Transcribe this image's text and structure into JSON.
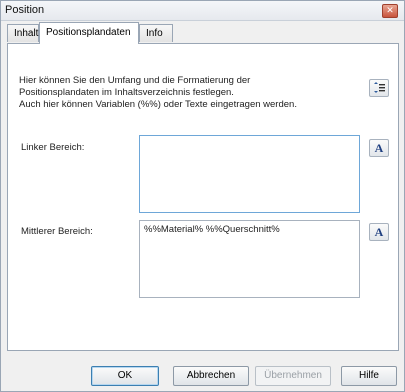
{
  "window": {
    "title": "Position",
    "close_glyph": "✕"
  },
  "tabs": [
    {
      "label": "Inhalt",
      "active": false
    },
    {
      "label": "Positionsplandaten",
      "active": true
    },
    {
      "label": "Info",
      "active": false
    }
  ],
  "description": {
    "line1": "Hier können Sie den Umfang und die Formatierung der",
    "line2": "Positionsplandaten im Inhaltsverzeichnis festlegen.",
    "line3": "Auch hier können Variablen (%%) oder Texte eingetragen werden."
  },
  "fields": {
    "left": {
      "label": "Linker Bereich:",
      "value": ""
    },
    "middle": {
      "label": "Mittlerer Bereich:",
      "value": "%%Material% %%Querschnitt%"
    }
  },
  "format_button_glyph": "A",
  "buttons": {
    "ok": "OK",
    "cancel": "Abbrechen",
    "apply": "Übernehmen",
    "help": "Hilfe"
  }
}
